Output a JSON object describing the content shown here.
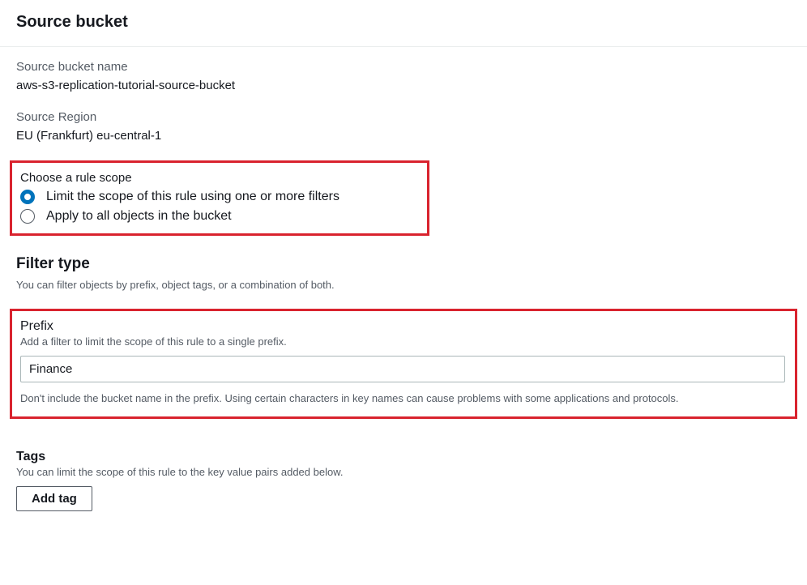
{
  "header": {
    "title": "Source bucket"
  },
  "source": {
    "name_label": "Source bucket name",
    "name_value": "aws-s3-replication-tutorial-source-bucket",
    "region_label": "Source Region",
    "region_value": "EU (Frankfurt) eu-central-1"
  },
  "scope": {
    "title": "Choose a rule scope",
    "options": [
      {
        "label": "Limit the scope of this rule using one or more filters",
        "selected": true
      },
      {
        "label": "Apply to all objects in the bucket",
        "selected": false
      }
    ]
  },
  "filter": {
    "heading": "Filter type",
    "help": "You can filter objects by prefix, object tags, or a combination of both."
  },
  "prefix": {
    "title": "Prefix",
    "help": "Add a filter to limit the scope of this rule to a single prefix.",
    "value": "Finance",
    "note": "Don't include the bucket name in the prefix. Using certain characters in key names can cause problems with some applications and protocols."
  },
  "tags": {
    "title": "Tags",
    "help": "You can limit the scope of this rule to the key value pairs added below.",
    "button": "Add tag"
  }
}
